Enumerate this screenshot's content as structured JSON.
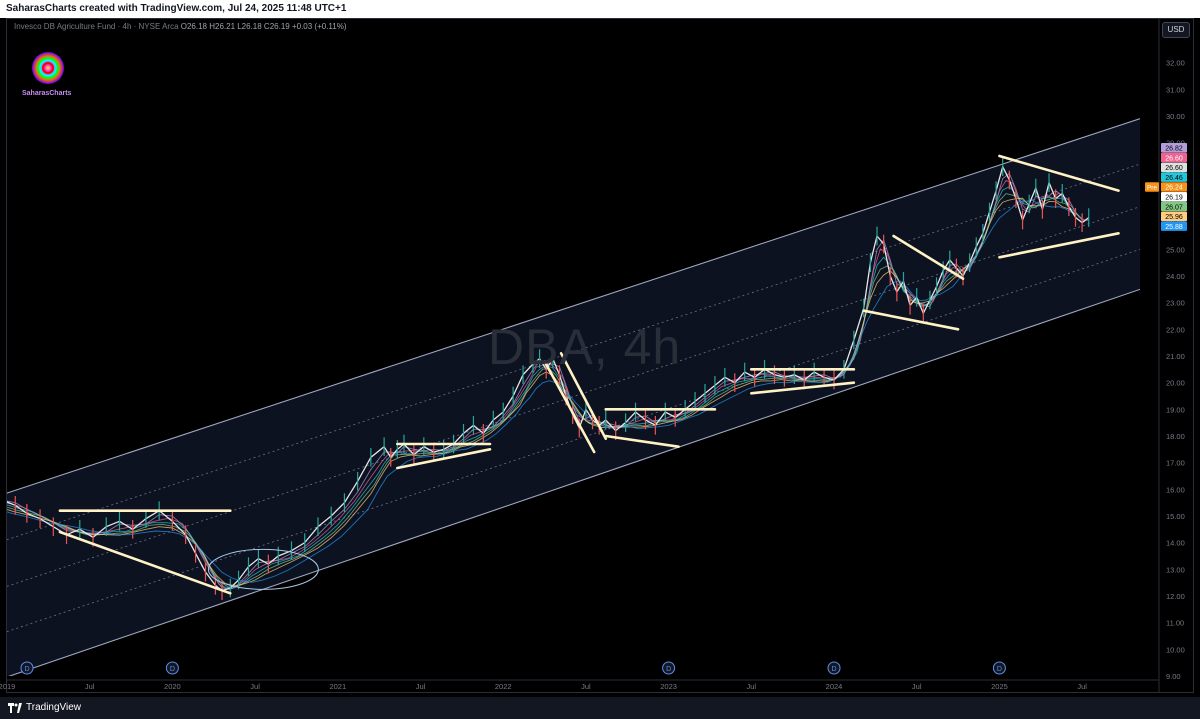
{
  "header": {
    "attribution": "SaharasCharts created with TradingView.com, Jul 24, 2025 11:48 UTC+1"
  },
  "legend": {
    "symbol": "Invesco DB Agriculture Fund · 4h · NYSE Arca",
    "ohlc": "O26.18 H26.21 L26.18 C26.19 +0.03 (+0.11%)"
  },
  "logo": {
    "label": "SaharasCharts"
  },
  "watermark": "DBA, 4h",
  "currency": "USD",
  "footer": {
    "brand": "TradingView"
  },
  "colors": {
    "background": "#000000",
    "channel_line": "#9fa6c0",
    "channel_fill": "#0c1220",
    "pattern_line": "#fff2c4",
    "candle_up": "#26a69a",
    "candle_down": "#ef5350"
  },
  "chart_data": {
    "type": "line",
    "title": "Invesco DB Agriculture Fund · 4h · NYSE Arca",
    "ylim": [
      9,
      33
    ],
    "y_ticks": [
      "9.00",
      "10.00",
      "11.00",
      "12.00",
      "13.00",
      "14.00",
      "15.00",
      "16.00",
      "17.00",
      "18.00",
      "19.00",
      "20.00",
      "21.00",
      "22.00",
      "23.00",
      "24.00",
      "25.00",
      "26.00",
      "27.00",
      "28.00",
      "29.00",
      "30.00",
      "31.00",
      "32.00"
    ],
    "x_ticks": [
      "2019",
      "Jul",
      "2020",
      "Jul",
      "2021",
      "Jul",
      "2022",
      "Jul",
      "2023",
      "Jul",
      "2024",
      "Jul",
      "2025",
      "Jul"
    ],
    "x_range": [
      2019.0,
      2025.85
    ],
    "dividend_markers": [
      2019.0,
      2020.0,
      2023.0,
      2024.0,
      2025.0
    ],
    "dividend_label": "D",
    "series": [
      {
        "name": "DBA",
        "x": [
          2018.97,
          2019.05,
          2019.12,
          2019.2,
          2019.28,
          2019.36,
          2019.44,
          2019.52,
          2019.6,
          2019.68,
          2019.76,
          2019.84,
          2019.92,
          2020.0,
          2020.08,
          2020.14,
          2020.2,
          2020.26,
          2020.3,
          2020.35,
          2020.4,
          2020.46,
          2020.52,
          2020.58,
          2020.64,
          2020.72,
          2020.8,
          2020.88,
          2020.96,
          2021.04,
          2021.12,
          2021.2,
          2021.28,
          2021.32,
          2021.36,
          2021.4,
          2021.46,
          2021.52,
          2021.58,
          2021.64,
          2021.7,
          2021.76,
          2021.82,
          2021.88,
          2021.94,
          2022.0,
          2022.06,
          2022.12,
          2022.18,
          2022.22,
          2022.26,
          2022.3,
          2022.34,
          2022.38,
          2022.42,
          2022.46,
          2022.5,
          2022.54,
          2022.58,
          2022.62,
          2022.68,
          2022.74,
          2022.8,
          2022.86,
          2022.92,
          2022.98,
          2023.04,
          2023.1,
          2023.16,
          2023.22,
          2023.28,
          2023.34,
          2023.4,
          2023.46,
          2023.52,
          2023.58,
          2023.64,
          2023.7,
          2023.76,
          2023.82,
          2023.88,
          2023.94,
          2024.0,
          2024.06,
          2024.12,
          2024.18,
          2024.22,
          2024.26,
          2024.3,
          2024.34,
          2024.38,
          2024.42,
          2024.46,
          2024.5,
          2024.54,
          2024.58,
          2024.62,
          2024.66,
          2024.7,
          2024.74,
          2024.78,
          2024.82,
          2024.86,
          2024.9,
          2024.94,
          2024.98,
          2025.02,
          2025.06,
          2025.1,
          2025.14,
          2025.18,
          2025.22,
          2025.26,
          2025.3,
          2025.34,
          2025.38,
          2025.42,
          2025.46,
          2025.5,
          2025.54
        ],
        "values": [
          15.6,
          15.4,
          15.1,
          14.9,
          14.6,
          14.3,
          14.5,
          14.2,
          14.6,
          14.8,
          14.5,
          14.9,
          15.2,
          14.8,
          14.3,
          13.6,
          12.9,
          12.4,
          12.2,
          12.3,
          12.6,
          13.1,
          13.4,
          13.2,
          13.5,
          13.7,
          14.0,
          14.6,
          15.0,
          15.5,
          16.3,
          17.2,
          17.6,
          17.2,
          17.5,
          17.7,
          17.3,
          17.6,
          17.4,
          17.5,
          17.7,
          18.1,
          18.4,
          18.1,
          18.6,
          18.9,
          19.5,
          20.3,
          20.7,
          20.9,
          20.5,
          20.9,
          20.3,
          19.5,
          18.8,
          18.3,
          19.0,
          18.6,
          18.4,
          18.6,
          18.2,
          18.5,
          18.9,
          18.6,
          18.4,
          18.9,
          18.7,
          19.0,
          19.3,
          19.6,
          19.9,
          20.2,
          20.0,
          20.4,
          20.2,
          20.5,
          20.3,
          20.2,
          20.3,
          20.1,
          20.4,
          20.2,
          20.1,
          20.5,
          21.6,
          22.8,
          24.5,
          25.5,
          25.2,
          24.0,
          23.4,
          23.8,
          22.9,
          23.2,
          22.6,
          23.1,
          23.6,
          24.2,
          24.6,
          24.3,
          24.0,
          24.5,
          25.1,
          25.6,
          26.4,
          27.2,
          28.1,
          27.6,
          26.9,
          26.1,
          26.7,
          27.3,
          26.5,
          27.5,
          26.9,
          27.1,
          26.6,
          26.2,
          26.0,
          26.19
        ]
      }
    ],
    "trend_channel": {
      "upper": {
        "x": [
          2018.97,
          2025.85
        ],
        "y": [
          15.8,
          29.9
        ]
      },
      "lower": {
        "x": [
          2018.97,
          2025.85
        ],
        "y": [
          8.9,
          23.5
        ]
      },
      "inner_lines": [
        {
          "x": [
            2018.97,
            2025.85
          ],
          "y": [
            14.05,
            28.2
          ]
        },
        {
          "x": [
            2018.97,
            2025.85
          ],
          "y": [
            12.3,
            26.6
          ]
        },
        {
          "x": [
            2018.97,
            2025.85
          ],
          "y": [
            10.6,
            25.0
          ]
        }
      ]
    },
    "pattern_lines": [
      {
        "x": [
          2019.32,
          2020.35
        ],
        "y": [
          15.2,
          15.2
        ]
      },
      {
        "x": [
          2019.32,
          2020.35
        ],
        "y": [
          14.4,
          12.1
        ]
      },
      {
        "x": [
          2021.36,
          2021.92
        ],
        "y": [
          17.7,
          17.7
        ]
      },
      {
        "x": [
          2021.36,
          2021.92
        ],
        "y": [
          16.8,
          17.5
        ]
      },
      {
        "x": [
          2022.25,
          2022.55
        ],
        "y": [
          20.8,
          17.4
        ]
      },
      {
        "x": [
          2022.35,
          2022.62
        ],
        "y": [
          21.1,
          17.9
        ]
      },
      {
        "x": [
          2022.62,
          2023.28
        ],
        "y": [
          19.0,
          19.0
        ]
      },
      {
        "x": [
          2022.62,
          2023.06
        ],
        "y": [
          18.0,
          17.6
        ]
      },
      {
        "x": [
          2023.5,
          2024.12
        ],
        "y": [
          20.5,
          20.5
        ]
      },
      {
        "x": [
          2023.5,
          2024.12
        ],
        "y": [
          19.6,
          20.0
        ]
      },
      {
        "x": [
          2024.18,
          2024.75
        ],
        "y": [
          22.7,
          22.0
        ]
      },
      {
        "x": [
          2024.36,
          2024.78
        ],
        "y": [
          25.5,
          23.9
        ]
      },
      {
        "x": [
          2025.0,
          2025.72
        ],
        "y": [
          28.5,
          27.2
        ]
      },
      {
        "x": [
          2025.0,
          2025.72
        ],
        "y": [
          24.7,
          25.6
        ]
      }
    ],
    "price_labels": [
      {
        "value": "26.82",
        "color": "#b39ddb"
      },
      {
        "value": "26.60",
        "color": "#f06292"
      },
      {
        "value": "26.60",
        "color": "#e0e0e0"
      },
      {
        "value": "26.46",
        "color": "#26c6da"
      },
      {
        "value": "26.24",
        "color": "#f7931a",
        "prefix": "Pre"
      },
      {
        "value": "26.19",
        "color": "#ffffff"
      },
      {
        "value": "26.07",
        "color": "#81c784"
      },
      {
        "value": "25.96",
        "color": "#ffcc80"
      },
      {
        "value": "25.88",
        "color": "#2196f3"
      }
    ]
  }
}
